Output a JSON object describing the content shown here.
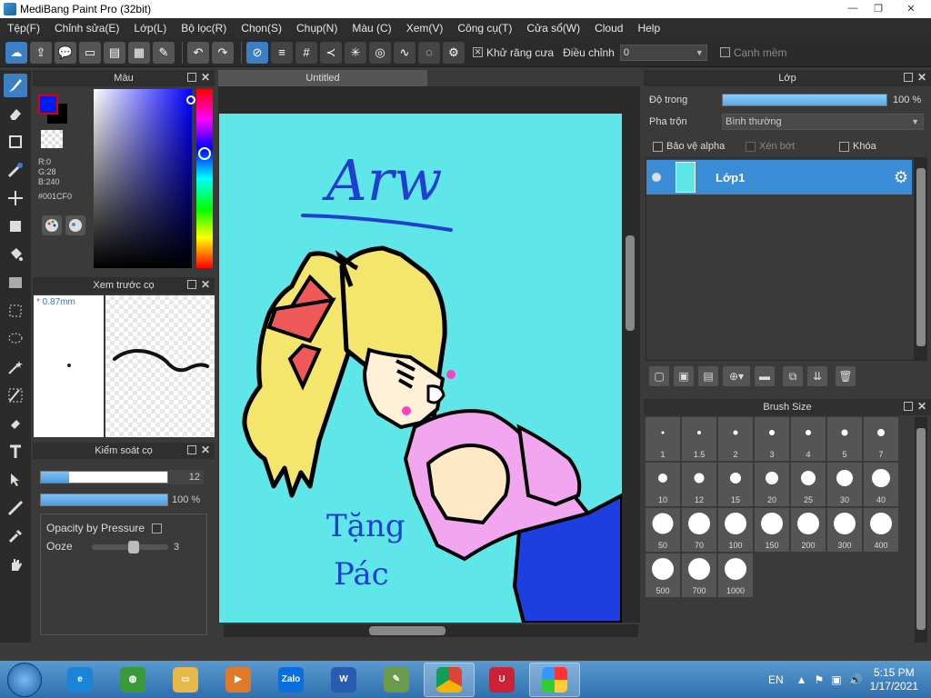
{
  "window": {
    "title": "MediBang Paint Pro (32bit)",
    "minimize": "—",
    "restore": "❐",
    "close": "✕"
  },
  "menu": [
    "Tệp(F)",
    "Chỉnh sửa(E)",
    "Lớp(L)",
    "Bộ lọc(R)",
    "Chọn(S)",
    "Chụp(N)",
    "Màu (C)",
    "Xem(V)",
    "Công cụ(T)",
    "Cửa sổ(W)",
    "Cloud",
    "Help"
  ],
  "toolbar": {
    "antialias_label": "Khử răng cưa",
    "antialias_checked": true,
    "adjust_label": "Điều chỉnh",
    "adjust_value": "0",
    "soft_edge_label": "Cạnh mềm",
    "soft_edge_checked": false
  },
  "color_panel": {
    "title": "Màu",
    "r": "R:0",
    "g": "G:28",
    "b": "B:240",
    "hex": "#001CF0",
    "fg_color": "#001CF0",
    "bg_color": "#000000"
  },
  "brush_preview": {
    "title": "Xem trước cọ",
    "size": "* 0.87mm"
  },
  "brush_control": {
    "title": "Kiểm soát cọ",
    "size_value": "12",
    "size_fraction": 0.22,
    "opacity_value": "100 %",
    "opacity_fraction": 1.0,
    "opacity_pressure_label": "Opacity by Pressure",
    "opacity_pressure_checked": false,
    "ooze_label": "Ooze",
    "ooze_value": "3"
  },
  "canvas": {
    "tab_title": "Untitled",
    "background_color": "#5fe6e9",
    "drawing_text_top": "Arw",
    "drawing_text_mid": "Tặng",
    "drawing_text_bottom": "Pác"
  },
  "layer_panel": {
    "title": "Lớp",
    "opacity_label": "Độ trong",
    "opacity_value": "100 %",
    "blend_label": "Pha trộn",
    "blend_value": "Bình thường",
    "protect_alpha_label": "Bảo vệ alpha",
    "clipping_label": "Xén bớt",
    "lock_label": "Khóa",
    "layers": [
      {
        "name": "Lớp1",
        "selected": true,
        "visible": true
      }
    ]
  },
  "brush_size_panel": {
    "title": "Brush Size",
    "sizes": [
      "1",
      "1.5",
      "2",
      "3",
      "4",
      "5",
      "7",
      "10",
      "12",
      "15",
      "20",
      "25",
      "30",
      "40",
      "50",
      "70",
      "100",
      "150",
      "200",
      "300",
      "400",
      "500",
      "700",
      "1000"
    ]
  },
  "taskbar": {
    "apps": [
      "Internet Explorer",
      "App",
      "File Explorer",
      "Media Player",
      "Zalo",
      "Word",
      "Paint",
      "Chrome",
      "App2",
      "MediBang Paint"
    ],
    "language": "EN",
    "time": "5:15 PM",
    "date": "1/17/2021"
  },
  "colors": {
    "accent": "#3d7fc6",
    "panel_bg": "#3a3a3a",
    "selected_layer": "#3a8cd6"
  }
}
